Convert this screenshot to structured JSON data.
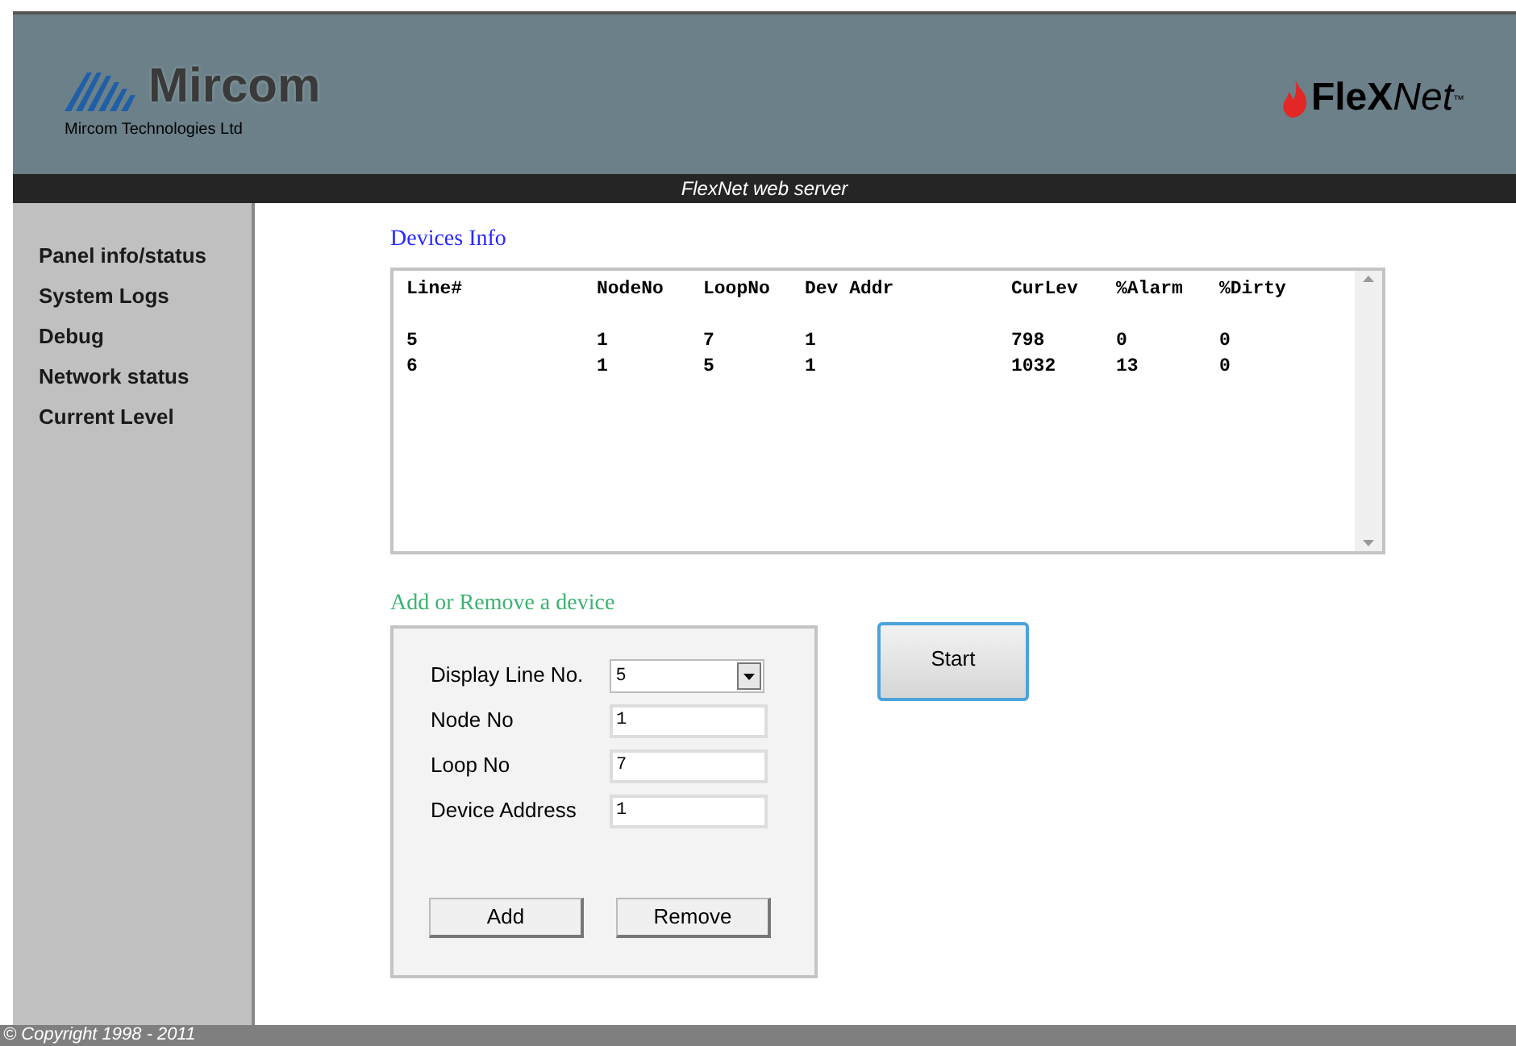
{
  "header": {
    "company_logo": "Mircom",
    "company_name": "Mircom Technologies Ltd",
    "product_logo": {
      "bold": "FleX",
      "italic": "Net",
      "mark": "™"
    },
    "title_bar": "FlexNet web server"
  },
  "sidebar": {
    "items": [
      {
        "label": "Panel info/status"
      },
      {
        "label": "System Logs"
      },
      {
        "label": "Debug"
      },
      {
        "label": "Network status"
      },
      {
        "label": "Current Level"
      }
    ]
  },
  "devices_info": {
    "title": "Devices Info",
    "columns": [
      "Line#",
      "NodeNo",
      "LoopNo",
      "Dev Addr",
      "CurLev",
      "%Alarm",
      "%Dirty"
    ],
    "rows": [
      [
        "5",
        "1",
        "7",
        "1",
        "798",
        "0",
        "0"
      ],
      [
        "6",
        "1",
        "5",
        "1",
        "1032",
        "13",
        "0"
      ]
    ]
  },
  "add_remove": {
    "title": "Add or Remove a device",
    "fields": [
      {
        "kind": "select",
        "label": "Display Line No.",
        "value": "5"
      },
      {
        "kind": "text",
        "label": "Node No",
        "value": "1"
      },
      {
        "kind": "text",
        "label": "Loop No",
        "value": "7"
      },
      {
        "kind": "text",
        "label": "Device Address",
        "value": "1"
      }
    ],
    "buttons": [
      "Add",
      "Remove"
    ]
  },
  "start_button": "Start",
  "footer": "© Copyright  1998 - 2011"
}
